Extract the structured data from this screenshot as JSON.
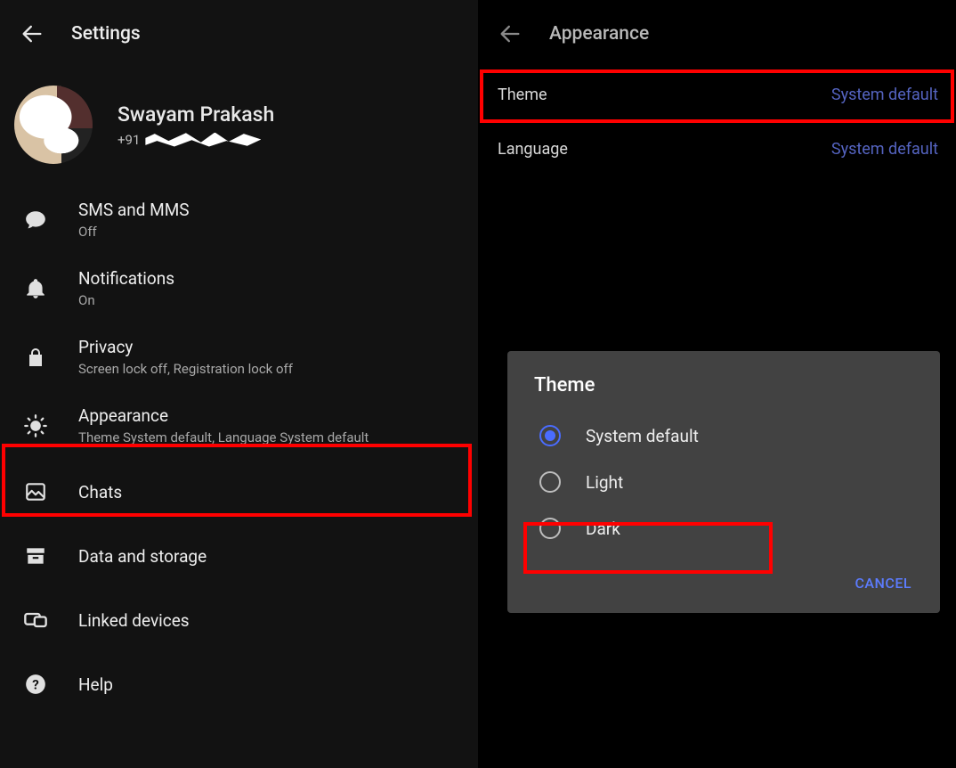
{
  "left": {
    "header_title": "Settings",
    "profile": {
      "name": "Swayam Prakash",
      "phone_prefix": "+91"
    },
    "items": [
      {
        "icon": "chat",
        "label": "SMS and MMS",
        "sub": "Off"
      },
      {
        "icon": "bell",
        "label": "Notifications",
        "sub": "On"
      },
      {
        "icon": "lock",
        "label": "Privacy",
        "sub": "Screen lock off, Registration lock off"
      },
      {
        "icon": "sun",
        "label": "Appearance",
        "sub": "Theme System default, Language System default"
      },
      {
        "icon": "image",
        "label": "Chats",
        "sub": ""
      },
      {
        "icon": "archive",
        "label": "Data and storage",
        "sub": ""
      },
      {
        "icon": "link",
        "label": "Linked devices",
        "sub": ""
      },
      {
        "icon": "help",
        "label": "Help",
        "sub": ""
      }
    ]
  },
  "right": {
    "header_title": "Appearance",
    "rows": [
      {
        "key": "Theme",
        "value": "System default"
      },
      {
        "key": "Language",
        "value": "System default"
      }
    ],
    "dialog": {
      "title": "Theme",
      "options": [
        {
          "label": "System default",
          "selected": true
        },
        {
          "label": "Light",
          "selected": false
        },
        {
          "label": "Dark",
          "selected": false
        }
      ],
      "cancel": "CANCEL"
    }
  }
}
